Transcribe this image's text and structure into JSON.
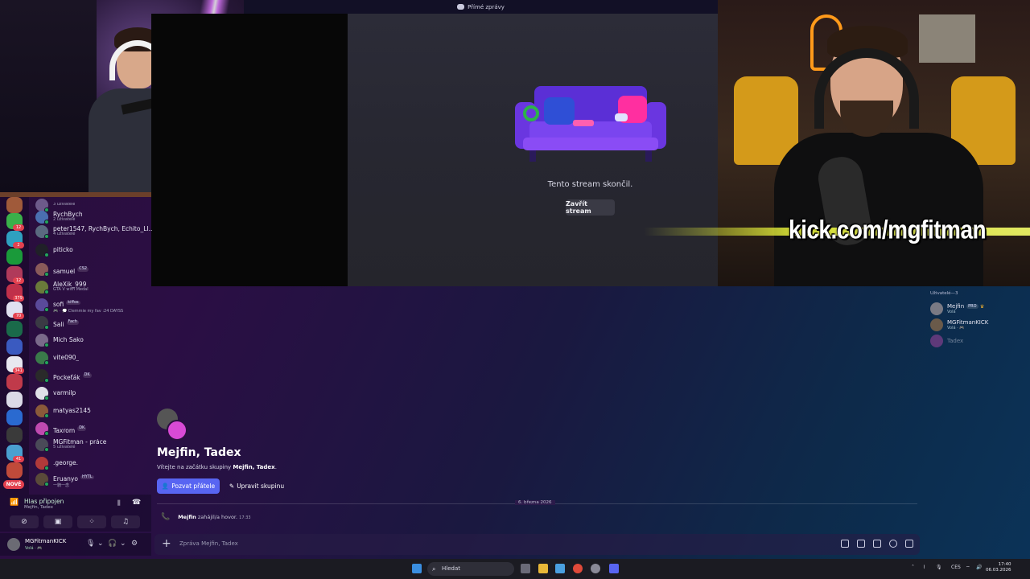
{
  "titlebar": {
    "label": "Přímé zprávy"
  },
  "stream": {
    "ended_text": "Tento stream skončil.",
    "close_button": "Zavřít stream"
  },
  "overlay": {
    "kick_text": "kick.com/mgfitman"
  },
  "dm_list": [
    {
      "name": "",
      "sub": "3 uživatelé",
      "color": "#6d5a8a"
    },
    {
      "name": "RychBych",
      "sub": "2 uživatelé",
      "color": "#4a6fb0"
    },
    {
      "name": "peter1547, RychBych, Echito_LI...",
      "sub": "4 uživatelé",
      "color": "#5a6a80"
    },
    {
      "name": "piticko",
      "sub": "",
      "color": "#202028"
    },
    {
      "name": "samuel",
      "tag": "CS2",
      "sub": "",
      "color": "#8a5a5a"
    },
    {
      "name": "AleXik_999",
      "sub": "GTA V with Medal",
      "color": "#6a7a3a"
    },
    {
      "name": "sofi",
      "tag": "kiffos",
      "sub": "🎮 · 💭 Clemmie my fav :24 DAYSS",
      "color": "#5a4a9a"
    },
    {
      "name": "Sali",
      "tag": "Fach",
      "sub": "",
      "color": "#3a3a44"
    },
    {
      "name": "Mich Sako",
      "sub": "",
      "color": "#7a6a8a"
    },
    {
      "name": "vite090_",
      "sub": "",
      "color": "#3a7a4a"
    },
    {
      "name": "Pockeťák",
      "tag": "DK",
      "sub": "",
      "color": "#2a2a2a"
    },
    {
      "name": "varmilp",
      "sub": "",
      "color": "#e0e0e8"
    },
    {
      "name": "matyas2145",
      "sub": "",
      "color": "#8a5a3a"
    },
    {
      "name": "Taxrom",
      "tag": "DK",
      "sub": "",
      "color": "#c04ab0"
    },
    {
      "name": "MGFitman - práce",
      "sub": "5 uživatelé",
      "color": "#4a4a58"
    },
    {
      "name": ".george.",
      "sub": "",
      "color": "#b03a3a"
    },
    {
      "name": "Eruanyo",
      "tag": "HYTL",
      "sub": "一騎一念",
      "color": "#5a4a3a"
    }
  ],
  "server_rail": {
    "badges": [
      "12",
      "2",
      "12",
      "379",
      "70",
      "341",
      "41"
    ],
    "new_label": "NOVÉ"
  },
  "voice": {
    "title": "Hlas připojen",
    "subtitle": "Mejfin, Tadex"
  },
  "user": {
    "name": "MGFitmanKICK",
    "status": "Volá · 🎮"
  },
  "group": {
    "title": "Mejfin, Tadex",
    "welcome_prefix": "Vítejte na začátku skupiny ",
    "welcome_name": "Mejfin, Tadex",
    "welcome_suffix": ".",
    "invite_button": "Pozvat přátele",
    "edit_button": "Upravit skupinu"
  },
  "messages": {
    "date_divider": "6. března 2026",
    "call_user": "Mejfin",
    "call_text": "zahájil/a hovor.",
    "call_time": "17:33"
  },
  "composer": {
    "placeholder": "Zpráva Mejfin, Tadex"
  },
  "members": {
    "header": "Uživatelé—3",
    "list": [
      {
        "name": "Mejfin",
        "tag": "PRO",
        "status": "Volá",
        "color": "#7a7a84"
      },
      {
        "name": "MGFitmanKICK",
        "status": "Volá · 🎮",
        "color": "#6a5a4a"
      },
      {
        "name": "Tadex",
        "status": "",
        "color": "#c04ab0"
      }
    ]
  },
  "taskbar": {
    "search": "Hledat",
    "lang": "CES",
    "time": "17:40",
    "date": "06.03.2026"
  }
}
